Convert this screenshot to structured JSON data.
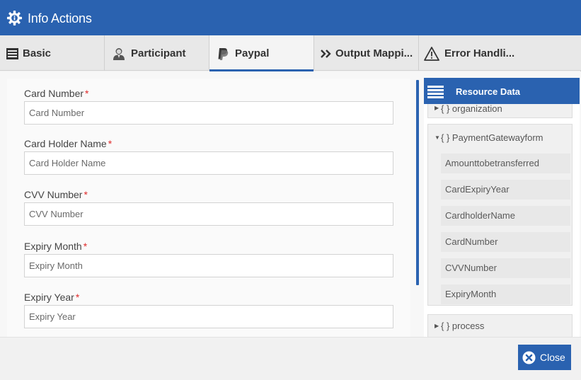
{
  "window": {
    "title": "Info Actions",
    "icon": "gear-info-icon"
  },
  "tabs": [
    {
      "label": "Basic",
      "icon": "form-icon",
      "active": false
    },
    {
      "label": "Participant",
      "icon": "user-icon",
      "active": false
    },
    {
      "label": "Paypal",
      "icon": "paypal-icon",
      "active": true
    },
    {
      "label": "Output Mappi...",
      "icon": "double-chevron-icon",
      "active": false
    },
    {
      "label": "Error Handli...",
      "icon": "warning-icon",
      "active": false
    }
  ],
  "form": {
    "required_marker": "*",
    "fields": [
      {
        "label": "Card Number",
        "placeholder": "Card Number",
        "value": ""
      },
      {
        "label": "Card Holder Name",
        "placeholder": "Card Holder Name",
        "value": ""
      },
      {
        "label": "CVV Number",
        "placeholder": "CVV Number",
        "value": ""
      },
      {
        "label": "Expiry Month",
        "placeholder": "Expiry Month",
        "value": ""
      },
      {
        "label": "Expiry Year",
        "placeholder": "Expiry Year",
        "value": ""
      }
    ]
  },
  "resource": {
    "header": "Resource Data",
    "nodes": {
      "organization": "{ } organization",
      "payment": "{ } PaymentGatewayform",
      "process": "{ } process"
    },
    "payment_items": [
      "Amounttobetransferred",
      "CardExpiryYear",
      "CardholderName",
      "CardNumber",
      "CVVNumber",
      "ExpiryMonth"
    ]
  },
  "footer": {
    "close_label": "Close"
  },
  "colors": {
    "accent": "#2a62b0",
    "required": "#e02b2b"
  }
}
